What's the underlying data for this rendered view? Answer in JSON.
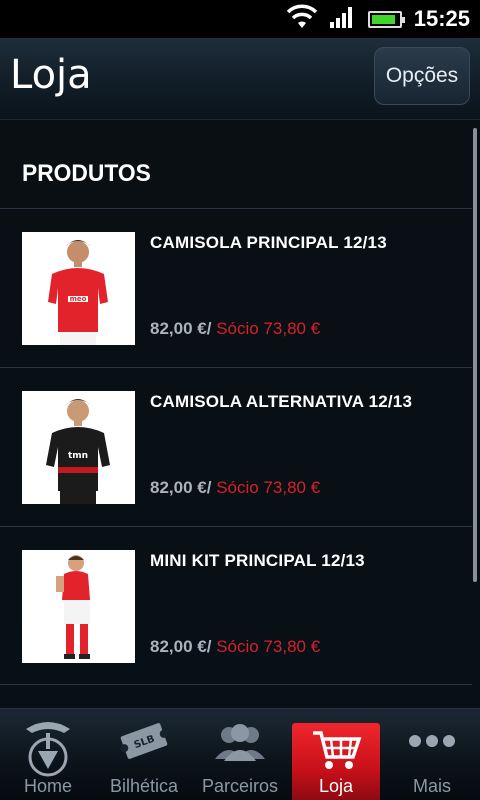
{
  "status_bar": {
    "time": "15:25",
    "battery_level": 0.9,
    "icons": [
      "wifi-icon",
      "signal-icon",
      "battery-icon"
    ]
  },
  "header": {
    "title": "Loja",
    "options_label": "Opções"
  },
  "products_section": {
    "title": "PRODUTOS",
    "items": [
      {
        "name": "CAMISOLA PRINCIPAL 12/13",
        "price": "82,00 €/",
        "member_price": "Sócio 73,80 €",
        "image": "red-jersey-player",
        "sponsor": "meo"
      },
      {
        "name": "CAMISOLA ALTERNATIVA 12/13",
        "price": "82,00 €/",
        "member_price": "Sócio 73,80 €",
        "image": "black-jersey-player",
        "sponsor": "tmn"
      },
      {
        "name": "MINI KIT PRINCIPAL 12/13",
        "price": "82,00 €/",
        "member_price": "Sócio 73,80 €",
        "image": "child-red-kit"
      }
    ]
  },
  "bottom_nav": {
    "items": [
      {
        "label": "Home",
        "icon": "eagle-crest-icon"
      },
      {
        "label": "Bilhética",
        "icon": "ticket-icon"
      },
      {
        "label": "Parceiros",
        "icon": "people-icon"
      },
      {
        "label": "Loja",
        "icon": "cart-icon"
      },
      {
        "label": "Mais",
        "icon": "more-dots-icon"
      }
    ],
    "active": "Loja"
  },
  "colors": {
    "accent_red": "#d8202a",
    "price_gray": "#aab4be",
    "battery_green": "#3fd52a"
  }
}
